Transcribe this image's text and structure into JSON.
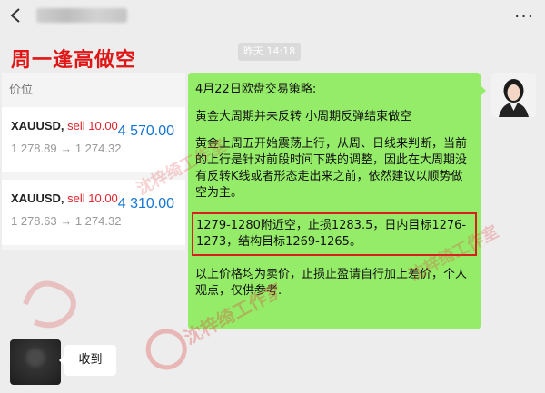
{
  "header": {
    "chat_title_blurred": true,
    "more_icon": "more-icon",
    "back_icon": "back-icon"
  },
  "timestamp": "昨天 14:18",
  "overlay_title": "周一逢高做空",
  "quote_panel": {
    "header": "价位",
    "rows": [
      {
        "symbol": "XAUUSD,",
        "side": " sell 10.00",
        "range": "1 278.89 → 1 274.32",
        "price": "4 570.00"
      },
      {
        "symbol": "XAUUSD,",
        "side": " sell 10.00",
        "range": "1 278.63 → 1 274.32",
        "price": "4 310.00"
      }
    ]
  },
  "message_green": {
    "paragraphs": [
      "4月22日欧盘交易策略:",
      "黄金大周期并未反转 小周期反弹结束做空",
      "黄金上周五开始震荡上行，从周、日线来判断，当前的上行是针对前段时间下跌的调整，因此在大周期没有反转K线或者形态走出来之前，依然建议以顺势做空为主。",
      "1279-1280附近空，止损1283.5，日内目标1276-1273，结构目标1269-1265。",
      "以上价格均为卖价，止损止盈请自行加上差价，个人观点，仅供参考."
    ]
  },
  "message_left": {
    "text": "收到"
  },
  "watermark": {
    "brand": "沈梓绮工作室"
  },
  "colors": {
    "background": "#ededed",
    "bubble_green": "#95ec69",
    "title_red": "#e01515",
    "price_blue": "#1476d4",
    "sell_red": "#e0242b",
    "highlight_border": "#d81e1e"
  }
}
